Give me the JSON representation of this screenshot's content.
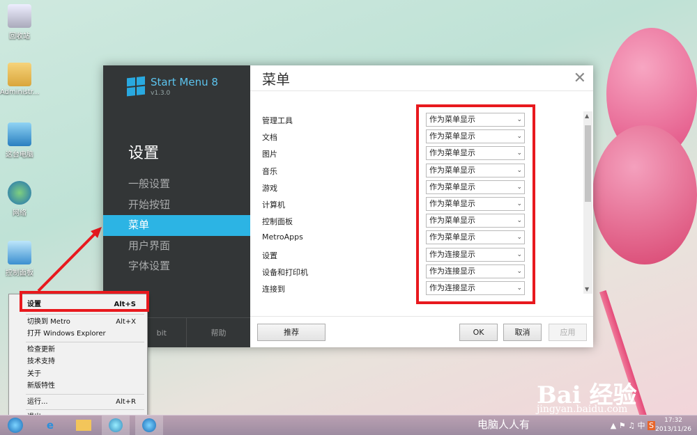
{
  "desktop": {
    "icons": [
      {
        "label": "回收站",
        "icon": "recycle-bin-icon"
      },
      {
        "label": "Administr...",
        "icon": "user-folder-icon"
      },
      {
        "label": "这台电脑",
        "icon": "computer-icon"
      },
      {
        "label": "网络",
        "icon": "network-icon"
      },
      {
        "label": "控制面板",
        "icon": "control-panel-icon"
      }
    ]
  },
  "window": {
    "app_name": "Start Menu 8",
    "version": "v1.3.0",
    "sidebar_heading": "设置",
    "nav": [
      "一般设置",
      "开始按钮",
      "菜单",
      "用户界面",
      "字体设置"
    ],
    "active_nav": "菜单",
    "bottom_links": [
      "bit",
      "帮助"
    ],
    "title": "菜单",
    "close_symbol": "✕",
    "rows": [
      {
        "label": "管理工具",
        "value": "作为菜单显示"
      },
      {
        "label": "文档",
        "value": "作为菜单显示"
      },
      {
        "label": "图片",
        "value": "作为菜单显示"
      },
      {
        "label": "音乐",
        "value": "作为菜单显示"
      },
      {
        "label": "游戏",
        "value": "作为菜单显示"
      },
      {
        "label": "计算机",
        "value": "作为菜单显示"
      },
      {
        "label": "控制面板",
        "value": "作为菜单显示"
      },
      {
        "label": "MetroApps",
        "value": "作为菜单显示"
      },
      {
        "label": "设置",
        "value": "作为连接显示"
      },
      {
        "label": "设备和打印机",
        "value": "作为连接显示"
      },
      {
        "label": "连接到",
        "value": "作为连接显示"
      }
    ],
    "buttons": {
      "recommend": "推荐",
      "ok": "OK",
      "cancel": "取消",
      "apply": "应用"
    }
  },
  "context_menu": {
    "items": [
      {
        "label": "设置",
        "shortcut": "Alt+S"
      },
      {
        "label": "切换到 Metro",
        "shortcut": "Alt+X"
      },
      {
        "label": "打开 Windows Explorer",
        "shortcut": ""
      },
      {
        "label": "检查更新",
        "shortcut": ""
      },
      {
        "label": "技术支持",
        "shortcut": ""
      },
      {
        "label": "关于",
        "shortcut": ""
      },
      {
        "label": "新版特性",
        "shortcut": ""
      },
      {
        "label": "运行...",
        "shortcut": "Alt+R"
      },
      {
        "label": "退出",
        "shortcut": ""
      }
    ]
  },
  "taskbar": {
    "time": "17:32",
    "date": "2013/11/26",
    "ime": "中",
    "tray_text": "电脑人人有"
  },
  "watermark": {
    "brand": "Bai 经验",
    "url": "jingyan.baidu.com"
  },
  "colors": {
    "accent": "#2cb4e4",
    "highlight": "#e8191e",
    "sidebar": "#333637"
  }
}
